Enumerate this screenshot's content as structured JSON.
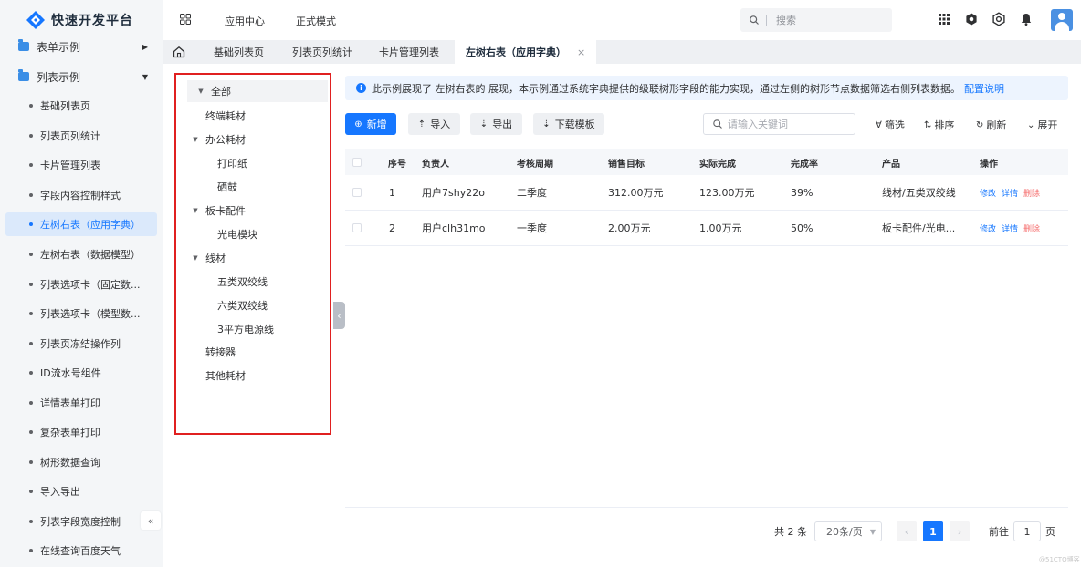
{
  "app": {
    "title": "快速开发平台",
    "brand_color": "#1677ff",
    "icon": "logo-diamond-icon"
  },
  "sidebar": {
    "groups": [
      {
        "label": "表单示例",
        "icon": "folder-icon",
        "expanded": false
      },
      {
        "label": "列表示例",
        "icon": "folder-icon",
        "expanded": true
      }
    ],
    "items": [
      {
        "label": "基础列表页",
        "active": false
      },
      {
        "label": "列表页列统计",
        "active": false
      },
      {
        "label": "卡片管理列表",
        "active": false
      },
      {
        "label": "字段内容控制样式",
        "active": false
      },
      {
        "label": "左树右表（应用字典）",
        "active": true
      },
      {
        "label": "左树右表（数据模型）",
        "active": false
      },
      {
        "label": "列表选项卡（固定数...",
        "active": false
      },
      {
        "label": "列表选项卡（模型数...",
        "active": false
      },
      {
        "label": "列表页冻结操作列",
        "active": false
      },
      {
        "label": "ID流水号组件",
        "active": false
      },
      {
        "label": "详情表单打印",
        "active": false
      },
      {
        "label": "复杂表单打印",
        "active": false
      },
      {
        "label": "树形数据查询",
        "active": false
      },
      {
        "label": "导入导出",
        "active": false
      },
      {
        "label": "列表字段宽度控制",
        "active": false
      },
      {
        "label": "在线查询百度天气",
        "active": false
      }
    ],
    "collapse_label": "«"
  },
  "header": {
    "nav": [
      "应用中心",
      "正式模式"
    ],
    "search_placeholder": "搜索",
    "icons": [
      "apps-grid-icon",
      "settings-icon",
      "gear-icon",
      "bell-icon",
      "user-avatar-icon"
    ]
  },
  "tabs": [
    {
      "label": "基础列表页",
      "active": false
    },
    {
      "label": "列表页列统计",
      "active": false
    },
    {
      "label": "卡片管理列表",
      "active": false
    },
    {
      "label": "左树右表（应用字典）",
      "active": true,
      "close": "×"
    }
  ],
  "tree": [
    {
      "label": "全部",
      "level": 0,
      "expandable": true,
      "selected": true
    },
    {
      "label": "终端耗材",
      "level": 1,
      "expandable": false
    },
    {
      "label": "办公耗材",
      "level": 1,
      "expandable": true
    },
    {
      "label": "打印纸",
      "level": 2,
      "expandable": false
    },
    {
      "label": "硒鼓",
      "level": 2,
      "expandable": false
    },
    {
      "label": "板卡配件",
      "level": 1,
      "expandable": true
    },
    {
      "label": "光电模块",
      "level": 2,
      "expandable": false
    },
    {
      "label": "线材",
      "level": 1,
      "expandable": true
    },
    {
      "label": "五类双绞线",
      "level": 2,
      "expandable": false
    },
    {
      "label": "六类双绞线",
      "level": 2,
      "expandable": false
    },
    {
      "label": "3平方电源线",
      "level": 2,
      "expandable": false
    },
    {
      "label": "转接器",
      "level": 1,
      "expandable": false
    },
    {
      "label": "其他耗材",
      "level": 1,
      "expandable": false
    }
  ],
  "notice": {
    "text": "此示例展现了 左树右表的 展现，本示例通过系统字典提供的级联树形字段的能力实现，通过左侧的树形节点数据筛选右侧列表数据。",
    "link": "配置说明"
  },
  "toolbar": {
    "add": "新增",
    "import": "导入",
    "export": "导出",
    "download_template": "下载模板",
    "keyword_placeholder": "请输入关键词",
    "filter": "筛选",
    "sort": "排序",
    "refresh": "刷新",
    "expand": "展开"
  },
  "table": {
    "columns": [
      "序号",
      "负责人",
      "考核周期",
      "销售目标",
      "实际完成",
      "完成率",
      "产品",
      "操作"
    ],
    "rows": [
      {
        "index": "1",
        "owner": "用户7shy22o",
        "period": "二季度",
        "target": "312.00万元",
        "actual": "123.00万元",
        "rate": "39%",
        "product": "线材/五类双绞线"
      },
      {
        "index": "2",
        "owner": "用户clh31mo",
        "period": "一季度",
        "target": "2.00万元",
        "actual": "1.00万元",
        "rate": "50%",
        "product": "板卡配件/光电..."
      }
    ],
    "actions": {
      "edit": "修改",
      "detail": "详情",
      "delete": "删除"
    }
  },
  "pagination": {
    "total": "共 2 条",
    "page_size": "20条/页",
    "current_page": "1",
    "goto_label": "前往",
    "goto_value": "1",
    "page_unit": "页"
  },
  "watermark": "@51CTO博客"
}
